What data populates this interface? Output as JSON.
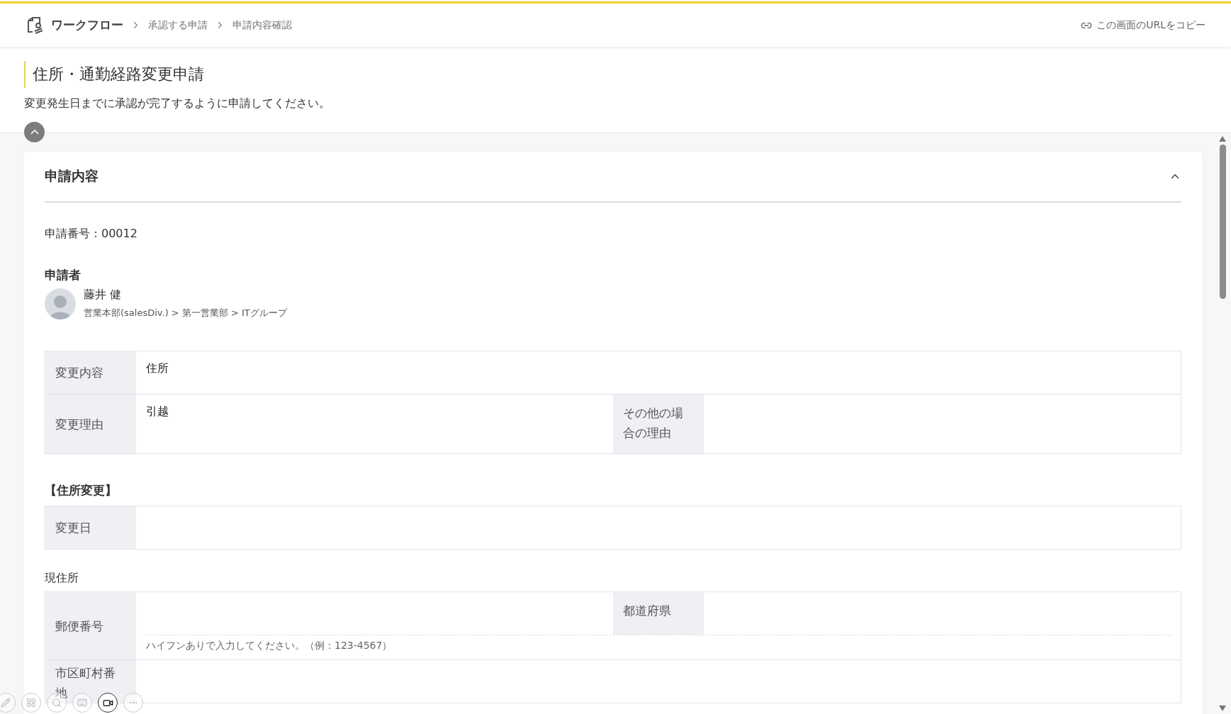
{
  "breadcrumb": [
    {
      "label": "ワークフロー",
      "kind": "root"
    },
    {
      "label": "承認する申請",
      "kind": "link"
    },
    {
      "label": "申請内容確認",
      "kind": "current"
    }
  ],
  "copy_url_link": "この画面のURLをコピー",
  "page_title": "住所・通勤経路変更申請",
  "page_description": "変更発生日までに承認が完了するように申請してください。",
  "section": {
    "title": "申請内容",
    "expanded": true,
    "application_number": "申請番号：00012",
    "applicant": {
      "heading": "申請者",
      "name": "藤井 健",
      "department": "営業本部(salesDiv.) > 第一営業部 > ITグループ"
    },
    "summary_table": [
      {
        "cells": [
          {
            "label": "変更内容",
            "value": "住所"
          }
        ]
      },
      {
        "cells": [
          {
            "label": "変更理由",
            "value": "引越"
          },
          {
            "label": "その他の場合の理由"
          }
        ]
      }
    ],
    "address_change": {
      "heading": "【住所変更】",
      "table": [
        {
          "cells": [
            {
              "label": "変更日"
            }
          ]
        }
      ]
    },
    "current_address": {
      "heading": "現住所",
      "table": [
        {
          "cells": [
            {
              "label": "郵便番号"
            },
            {
              "label": "都道府県"
            }
          ],
          "note": "ハイフンありで入力してください。（例：123-4567）"
        },
        {
          "cells": [
            {
              "label": "市区町村番地"
            }
          ]
        }
      ]
    }
  }
}
